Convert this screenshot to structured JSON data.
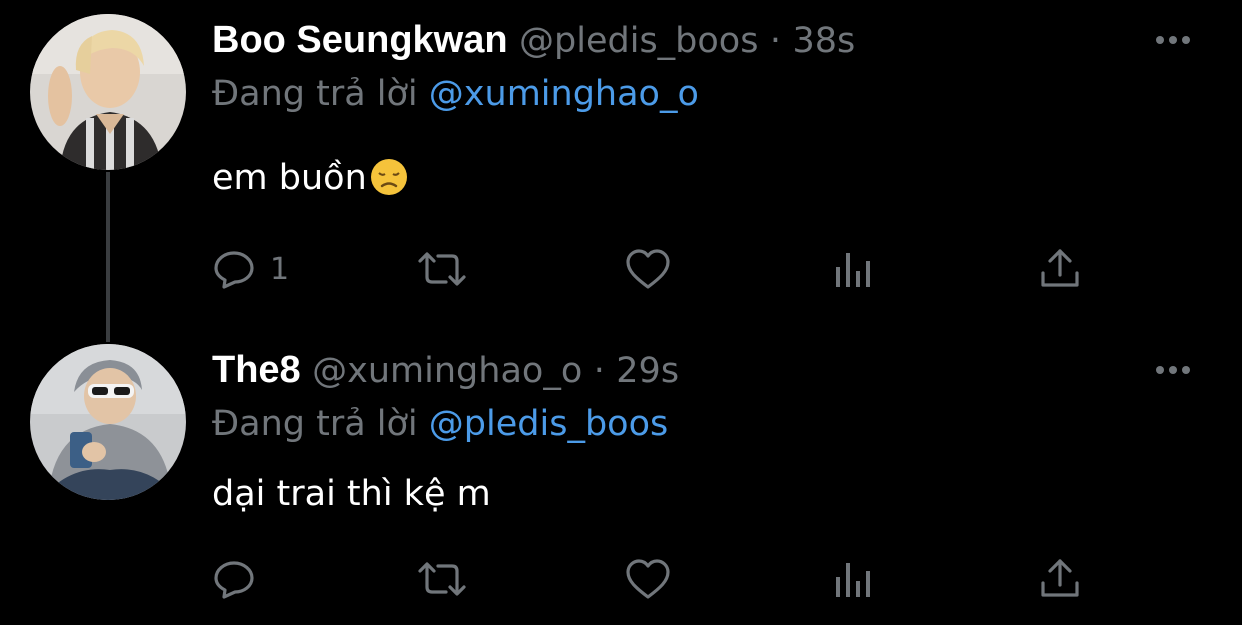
{
  "colors": {
    "background": "#000000",
    "name": "#ffffff",
    "muted": "#71767b",
    "link": "#4c9be8",
    "thread_line": "#3a3d40"
  },
  "tweets": [
    {
      "display_name": "Boo Seungkwan",
      "handle": "@pledis_boos",
      "separator": "·",
      "time": "38s",
      "reply_label": "Đang trả lời",
      "reply_to": "@xuminghao_o",
      "text": "em buồn",
      "emoji": "disappointed-face",
      "reply_count": "1",
      "avatar": "avatar-boo-seungkwan",
      "more_icon": "more-icon"
    },
    {
      "display_name": "The8",
      "handle": "@xuminghao_o",
      "separator": "·",
      "time": "29s",
      "reply_label": "Đang trả lời",
      "reply_to": "@pledis_boos",
      "text": "dại trai thì kệ m",
      "reply_count": "",
      "avatar": "avatar-the8",
      "more_icon": "more-icon"
    }
  ],
  "action_icons": [
    "reply-icon",
    "retweet-icon",
    "like-icon",
    "views-icon",
    "share-icon"
  ]
}
